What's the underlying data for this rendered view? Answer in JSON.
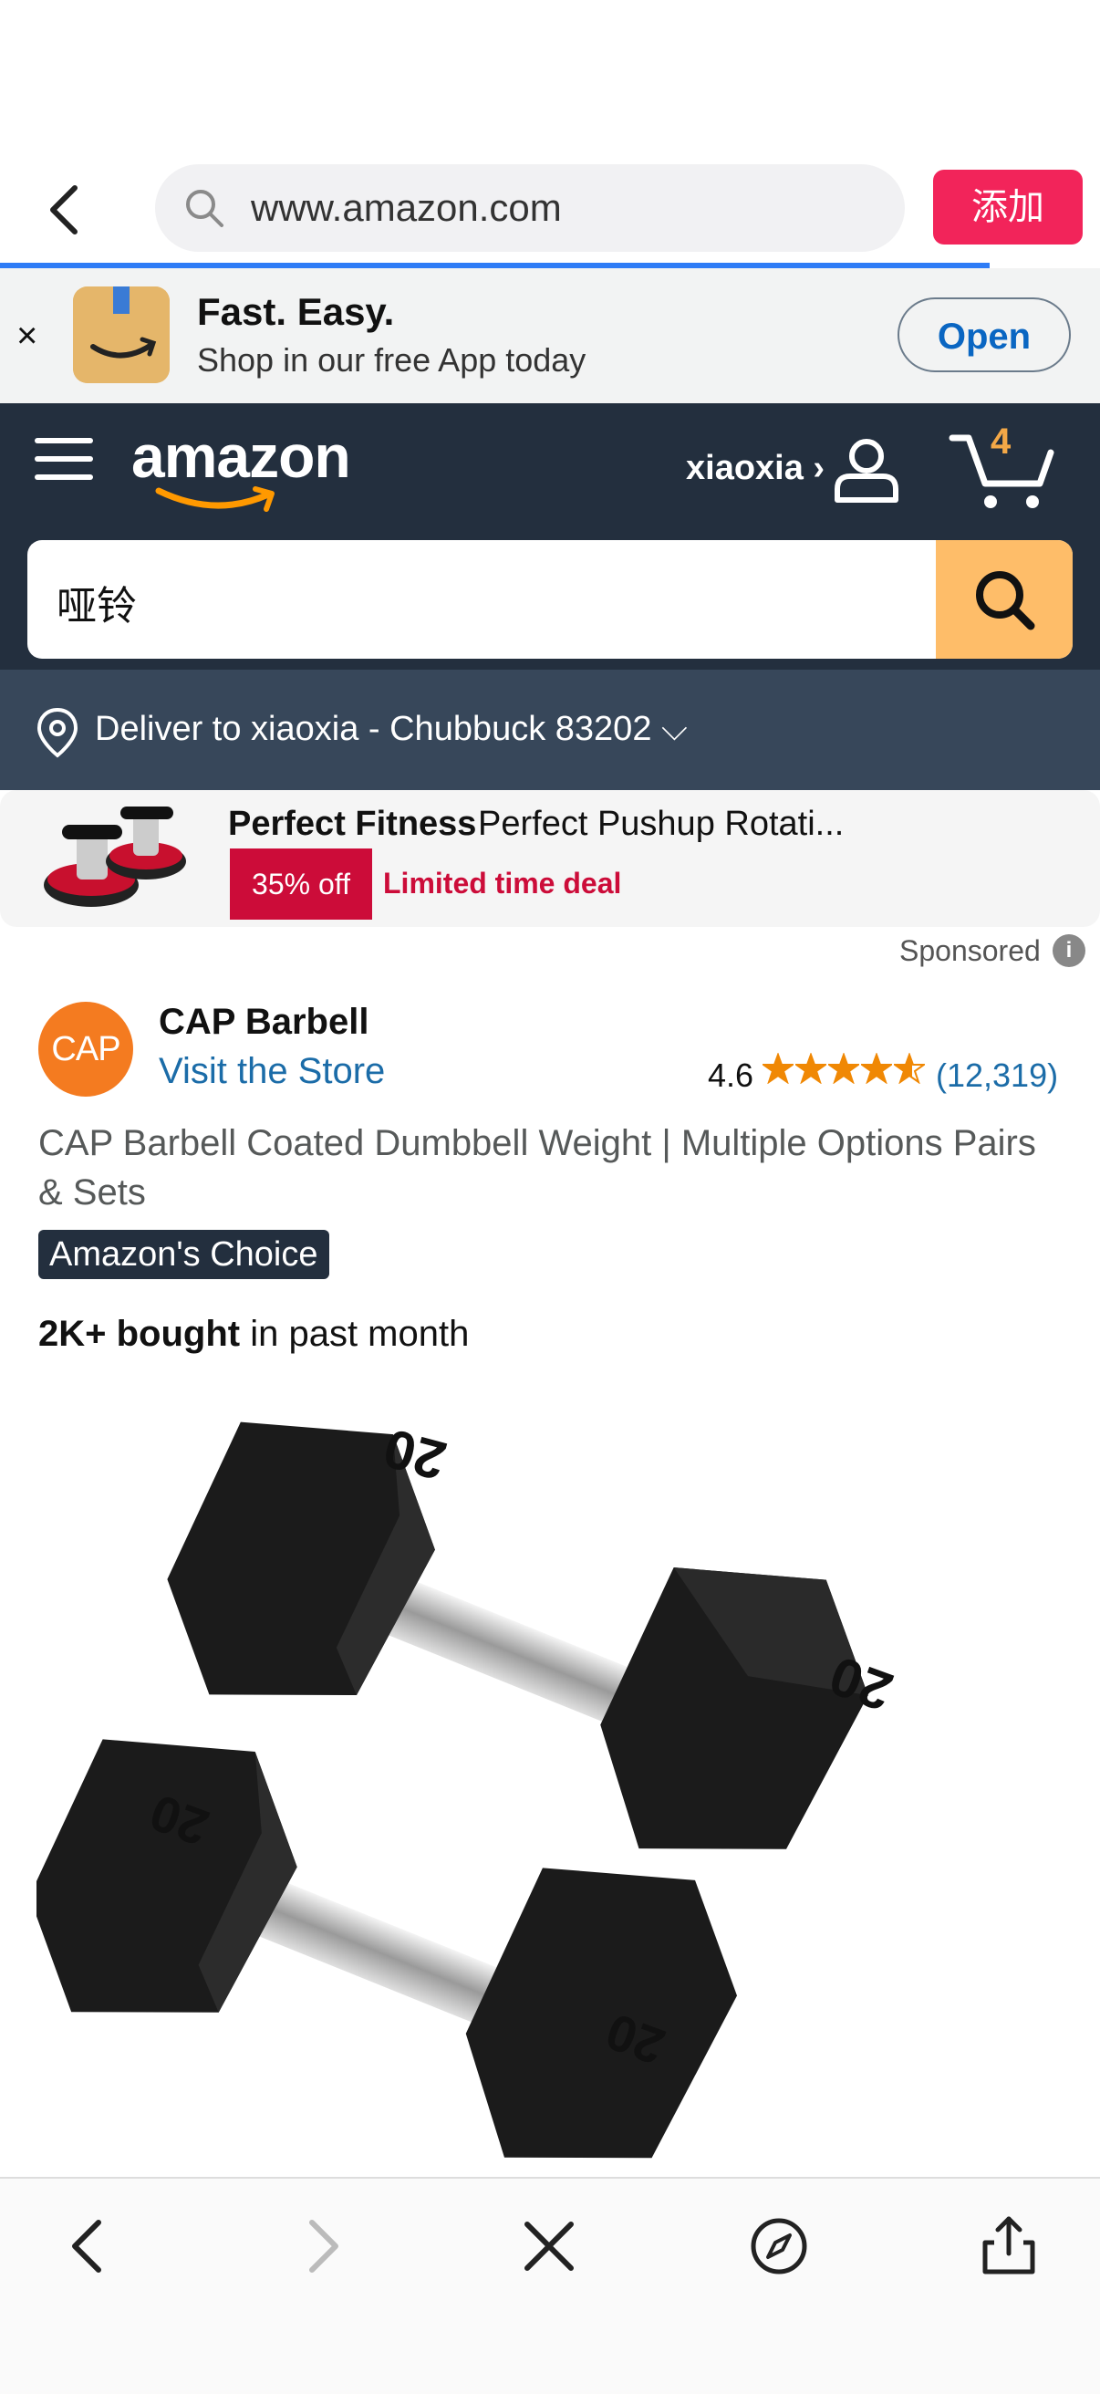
{
  "browser": {
    "url": "www.amazon.com",
    "add_label": "添加",
    "colors": {
      "add_button": "#f2245a",
      "progress": "#2e7cf6"
    }
  },
  "app_banner": {
    "title": "Fast. Easy.",
    "subtitle": "Shop in our free App today",
    "open_label": "Open",
    "close_glyph": "×"
  },
  "header": {
    "logo_text": "amazon",
    "account_name": "xiaoxia ›",
    "cart_count": "4",
    "search_value": "哑铃",
    "deliver_text": "Deliver to xiaoxia - Chubbuck 83202 ⌵"
  },
  "ad": {
    "brand": "Perfect Fitness",
    "title": "Perfect Pushup Rotati...",
    "discount": "35% off",
    "deal": "Limited time deal",
    "sponsored": "Sponsored",
    "info_glyph": "i"
  },
  "product": {
    "brand_logo_text": "CAP",
    "brand_name": "CAP Barbell",
    "visit_store": "Visit the Store",
    "rating": "4.6",
    "rating_value": 4.6,
    "review_count": "(12,319)",
    "title": "CAP Barbell Coated Dumbbell Weight | Multiple Options Pairs & Sets",
    "badge": "Amazon's Choice",
    "bought_bold": "2K+ bought",
    "bought_rest": " in past month",
    "dumbbell_label": "20"
  },
  "toolbar": {
    "icons": [
      "back-icon",
      "forward-icon",
      "close-icon",
      "compass-icon",
      "share-icon"
    ]
  }
}
